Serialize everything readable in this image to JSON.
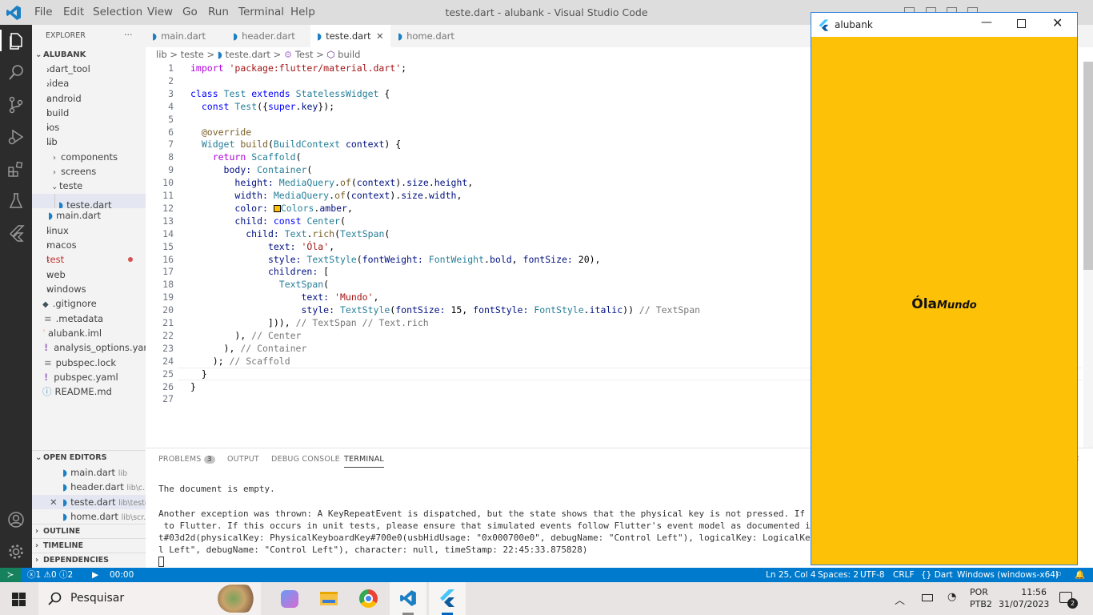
{
  "titlebar": {
    "menus": [
      "File",
      "Edit",
      "Selection",
      "View",
      "Go",
      "Run",
      "Terminal",
      "Help"
    ],
    "window_title": "teste.dart - alubank - Visual Studio Code"
  },
  "explorer": {
    "header": "EXPLORER",
    "more": "···",
    "root": "ALUBANK",
    "items": [
      {
        "label": ".dart_tool"
      },
      {
        "label": ".idea"
      },
      {
        "label": "android"
      },
      {
        "label": "build"
      },
      {
        "label": "ios"
      },
      {
        "label": "lib"
      },
      {
        "label": "components"
      },
      {
        "label": "screens"
      },
      {
        "label": "teste"
      },
      {
        "label": "teste.dart"
      },
      {
        "label": "main.dart"
      },
      {
        "label": "linux"
      },
      {
        "label": "macos"
      },
      {
        "label": "test"
      },
      {
        "label": "web"
      },
      {
        "label": "windows"
      },
      {
        "label": ".gitignore"
      },
      {
        "label": ".metadata"
      },
      {
        "label": "alubank.iml"
      },
      {
        "label": "analysis_options.yaml"
      },
      {
        "label": "pubspec.lock"
      },
      {
        "label": "pubspec.yaml"
      },
      {
        "label": "README.md"
      }
    ],
    "open_editors_title": "OPEN EDITORS",
    "open_editors": [
      {
        "name": "main.dart",
        "path": "lib"
      },
      {
        "name": "header.dart",
        "path": "lib\\c..."
      },
      {
        "name": "teste.dart",
        "path": "lib\\teste"
      },
      {
        "name": "home.dart",
        "path": "lib\\scr..."
      }
    ],
    "outline": "OUTLINE",
    "timeline": "TIMELINE",
    "dependencies": "DEPENDENCIES"
  },
  "tabs": [
    "main.dart",
    "header.dart",
    "teste.dart",
    "home.dart"
  ],
  "breadcrumb": [
    "lib",
    ">",
    "teste",
    ">",
    "teste.dart",
    ">",
    "Test",
    ">",
    "build"
  ],
  "code_lines": [
    {
      "n": "1",
      "html": "<span class='mc'>import</span> <span class='st'>'package:flutter/material.dart'</span>;"
    },
    {
      "n": "2",
      "html": ""
    },
    {
      "n": "3",
      "html": "<span class='kw'>class</span> <span class='ty'>Test</span> <span class='kw'>extends</span> <span class='ty'>StatelessWidget</span> {"
    },
    {
      "n": "4",
      "html": "  <span class='kw'>const</span> <span class='ty'>Test</span>({<span class='kw'>super</span>.<span class='pm'>key</span>});"
    },
    {
      "n": "5",
      "html": ""
    },
    {
      "n": "6",
      "html": "  <span class='an'>@override</span>"
    },
    {
      "n": "7",
      "html": "  <span class='ty'>Widget</span> <span class='fn'>build</span>(<span class='ty'>BuildContext</span> <span class='pm'>context</span>) {"
    },
    {
      "n": "8",
      "html": "    <span class='mc'>return</span> <span class='ty'>Scaffold</span>("
    },
    {
      "n": "9",
      "html": "      <span class='pm'>body:</span> <span class='ty'>Container</span>("
    },
    {
      "n": "10",
      "html": "        <span class='pm'>height:</span> <span class='ty'>MediaQuery</span>.<span class='fn'>of</span>(<span class='pm'>context</span>).<span class='pm'>size</span>.<span class='pm'>height</span>,"
    },
    {
      "n": "11",
      "html": "        <span class='pm'>width:</span> <span class='ty'>MediaQuery</span>.<span class='fn'>of</span>(<span class='pm'>context</span>).<span class='pm'>size</span>.<span class='pm'>width</span>,"
    },
    {
      "n": "12",
      "html": "        <span class='pm'>color:</span> <span style='display:inline-block;width:9px;height:9px;background:#ffc107;border:1px solid #000;vertical-align:-1px'></span><span class='ty'>Colors</span>.<span class='pm'>amber</span>,"
    },
    {
      "n": "13",
      "html": "        <span class='pm'>child:</span> <span class='kw'>const</span> <span class='ty'>Center</span>("
    },
    {
      "n": "14",
      "html": "          <span class='pm'>child:</span> <span class='ty'>Text</span>.<span class='fn'>rich</span>(<span class='ty'>TextSpan</span>("
    },
    {
      "n": "15",
      "html": "              <span class='pm'>text:</span> <span class='st'>'Óla'</span>,"
    },
    {
      "n": "16",
      "html": "              <span class='pm'>style:</span> <span class='ty'>TextStyle</span>(<span class='pm'>fontWeight:</span> <span class='ty'>FontWeight</span>.<span class='pm'>bold</span>, <span class='pm'>fontSize:</span> 20),"
    },
    {
      "n": "17",
      "html": "              <span class='pm'>children:</span> ["
    },
    {
      "n": "18",
      "html": "                <span class='ty'>TextSpan</span>("
    },
    {
      "n": "19",
      "html": "                    <span class='pm'>text:</span> <span class='st'>'Mundo'</span>,"
    },
    {
      "n": "20",
      "html": "                    <span class='pm'>style:</span> <span class='ty'>TextStyle</span>(<span class='pm'>fontSize:</span> 15, <span class='pm'>fontStyle:</span> <span class='ty'>FontStyle</span>.<span class='pm'>italic</span>)) <span style='color:#777'>// TextSpan</span>"
    },
    {
      "n": "21",
      "html": "              ])), <span style='color:#777'>// TextSpan // Text.rich</span>"
    },
    {
      "n": "22",
      "html": "        ), <span style='color:#777'>// Center</span>"
    },
    {
      "n": "23",
      "html": "      ), <span style='color:#777'>// Container</span>"
    },
    {
      "n": "24",
      "html": "    ); <span style='color:#777'>// Scaffold</span>"
    },
    {
      "n": "25",
      "html": "  }"
    },
    {
      "n": "26",
      "html": "}"
    },
    {
      "n": "27",
      "html": ""
    }
  ],
  "panel": {
    "tabs": [
      "PROBLEMS",
      "OUTPUT",
      "DEBUG CONSOLE",
      "TERMINAL"
    ],
    "problems_count": "3",
    "terminal_lines": [
      "The document is empty.",
      "",
      "Another exception was thrown: A KeyRepeatEvent is dispatched, but the state shows that the physical key is not pressed. If this occurs i",
      " to Flutter. If this occurs in unit tests, please ensure that simulated events follow Flutter's event model as documented in `HardwareKe",
      "t#03d2d(physicalKey: PhysicalKeyboardKey#700e0(usbHidUsage: \"0x000700e0\", debugName: \"Control Left\"), logicalKey: LogicalKeyboardKey#001",
      "l Left\", debugName: \"Control Left\"), character: null, timeStamp: 22:45:33.875828)"
    ]
  },
  "status": {
    "errors": "1",
    "warnings": "0",
    "infos": "2",
    "time": "00:00",
    "position": "Ln 25, Col 4",
    "spaces": "Spaces: 2",
    "encoding": "UTF-8",
    "eol": "CRLF",
    "language": "Dart",
    "device": "Windows (windows-x64)"
  },
  "taskbar": {
    "search_placeholder": "Pesquisar",
    "lang1": "POR",
    "lang2": "PTB2",
    "time": "11:56",
    "date": "31/07/2023",
    "notif_count": "2"
  },
  "flutter_window": {
    "title": "alubank",
    "text_bold": "Óla",
    "text_italic": "Mundo",
    "bg_color": "#fdc107"
  }
}
